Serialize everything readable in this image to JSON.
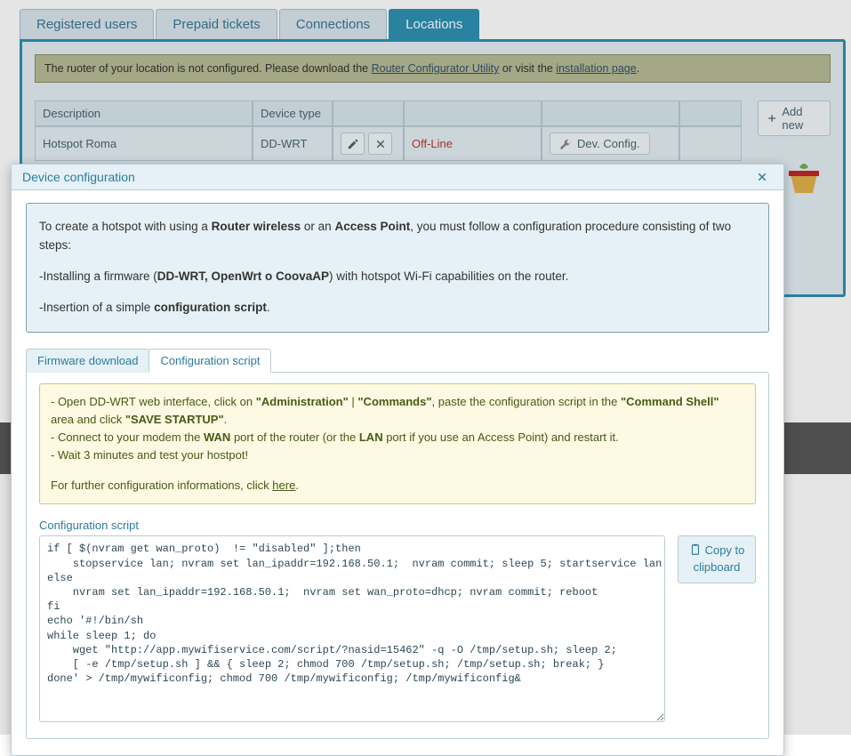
{
  "tabs": {
    "registered_users": "Registered users",
    "prepaid_tickets": "Prepaid tickets",
    "connections": "Connections",
    "locations": "Locations"
  },
  "notice": {
    "prefix": "The ruoter of your location is not configured. Please download the ",
    "link1": "Router Configurator Utility",
    "middle": " or visit the ",
    "link2": "installation page",
    "suffix": "."
  },
  "table": {
    "headers": {
      "description": "Description",
      "device_type": "Device type"
    },
    "row": {
      "description": "Hotspot Roma",
      "device_type": "DD-WRT",
      "status": "Off-Line",
      "dev_config": "Dev. Config."
    }
  },
  "addnew": "Add new",
  "modal": {
    "title": "Device configuration",
    "info_l1a": "To create a hotspot with using a ",
    "info_l1b": "Router wireless",
    "info_l1c": " or an ",
    "info_l1d": "Access Point",
    "info_l1e": ", you must follow a configuration procedure consisting of two steps:",
    "info_l2a": "-Installing a firmware (",
    "info_l2b": "DD-WRT, OpenWrt o CoovaAP",
    "info_l2c": ") with hotspot Wi-Fi capabilities on the router.",
    "info_l3a": "-Insertion of a simple ",
    "info_l3b": "configuration script",
    "info_l3c": ".",
    "inner_tabs": {
      "firmware": "Firmware download",
      "script": "Configuration script"
    },
    "yellow": {
      "l1a": "- Open DD-WRT web interface, click on ",
      "l1b": "\"Administration\"",
      "l1c": " | ",
      "l1d": "\"Commands\"",
      "l1e": ", paste the configuration script in the ",
      "l1f": "\"Command Shell\"",
      "l1g": " area and click ",
      "l1h": "\"SAVE STARTUP\"",
      "l1i": ".",
      "l2a": "- Connect to your modem the ",
      "l2b": "WAN",
      "l2c": " port of the router (or the ",
      "l2d": "LAN",
      "l2e": " port if you use an Access Point) and restart it.",
      "l3": "- Wait 3 minutes and test your hostpot!",
      "l4a": "For further configuration informations, click ",
      "l4link": "here",
      "l4b": "."
    },
    "script_label": "Configuration script",
    "script_value": "if [ $(nvram get wan_proto)  != \"disabled\" ];then\n    stopservice lan; nvram set lan_ipaddr=192.168.50.1;  nvram commit; sleep 5; startservice lan\nelse\n    nvram set lan_ipaddr=192.168.50.1;  nvram set wan_proto=dhcp; nvram commit; reboot\nfi\necho '#!/bin/sh\nwhile sleep 1; do\n    wget \"http://app.mywifiservice.com/script/?nasid=15462\" -q -O /tmp/setup.sh; sleep 2;\n    [ -e /tmp/setup.sh ] && { sleep 2; chmod 700 /tmp/setup.sh; /tmp/setup.sh; break; }\ndone' > /tmp/mywificonfig; chmod 700 /tmp/mywificonfig; /tmp/mywificonfig&",
    "copy_l1": "Copy to",
    "copy_l2": "clipboard"
  }
}
